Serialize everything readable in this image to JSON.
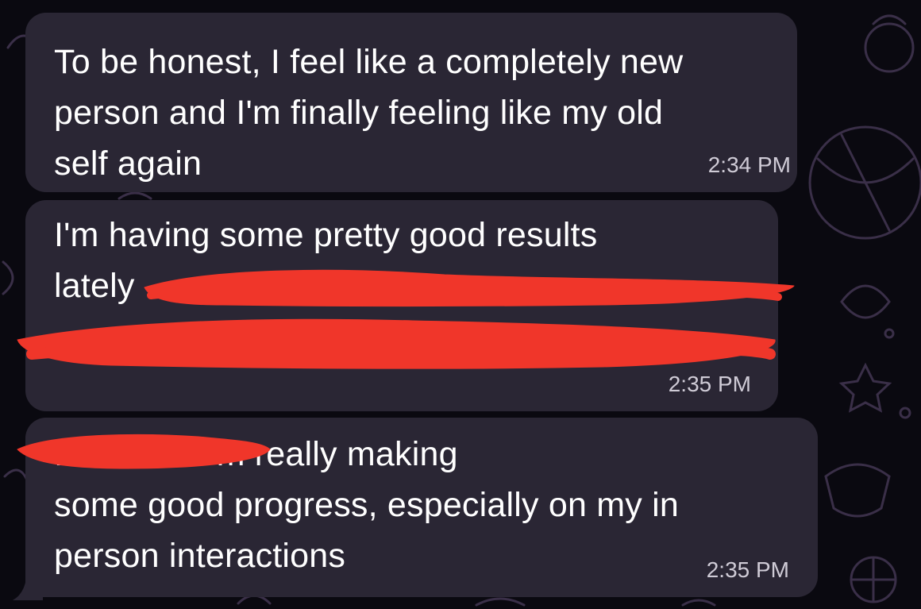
{
  "messages": [
    {
      "text": "To be honest, I feel like a completely new\nperson and I'm finally feeling like my old\nself again",
      "time": "2:34 PM"
    },
    {
      "text": "I'm having some pretty good results\nlately",
      "time": "2:35 PM"
    },
    {
      "text": "           I feel like I'm really making\nsome good progress, especially on my in\nperson interactions",
      "time": "2:35 PM"
    }
  ],
  "colors": {
    "background": "#0a0910",
    "bubble": "#2a2634",
    "text": "#ffffff",
    "timestamp": "#cfcbd6",
    "redaction": "#f0362a"
  }
}
